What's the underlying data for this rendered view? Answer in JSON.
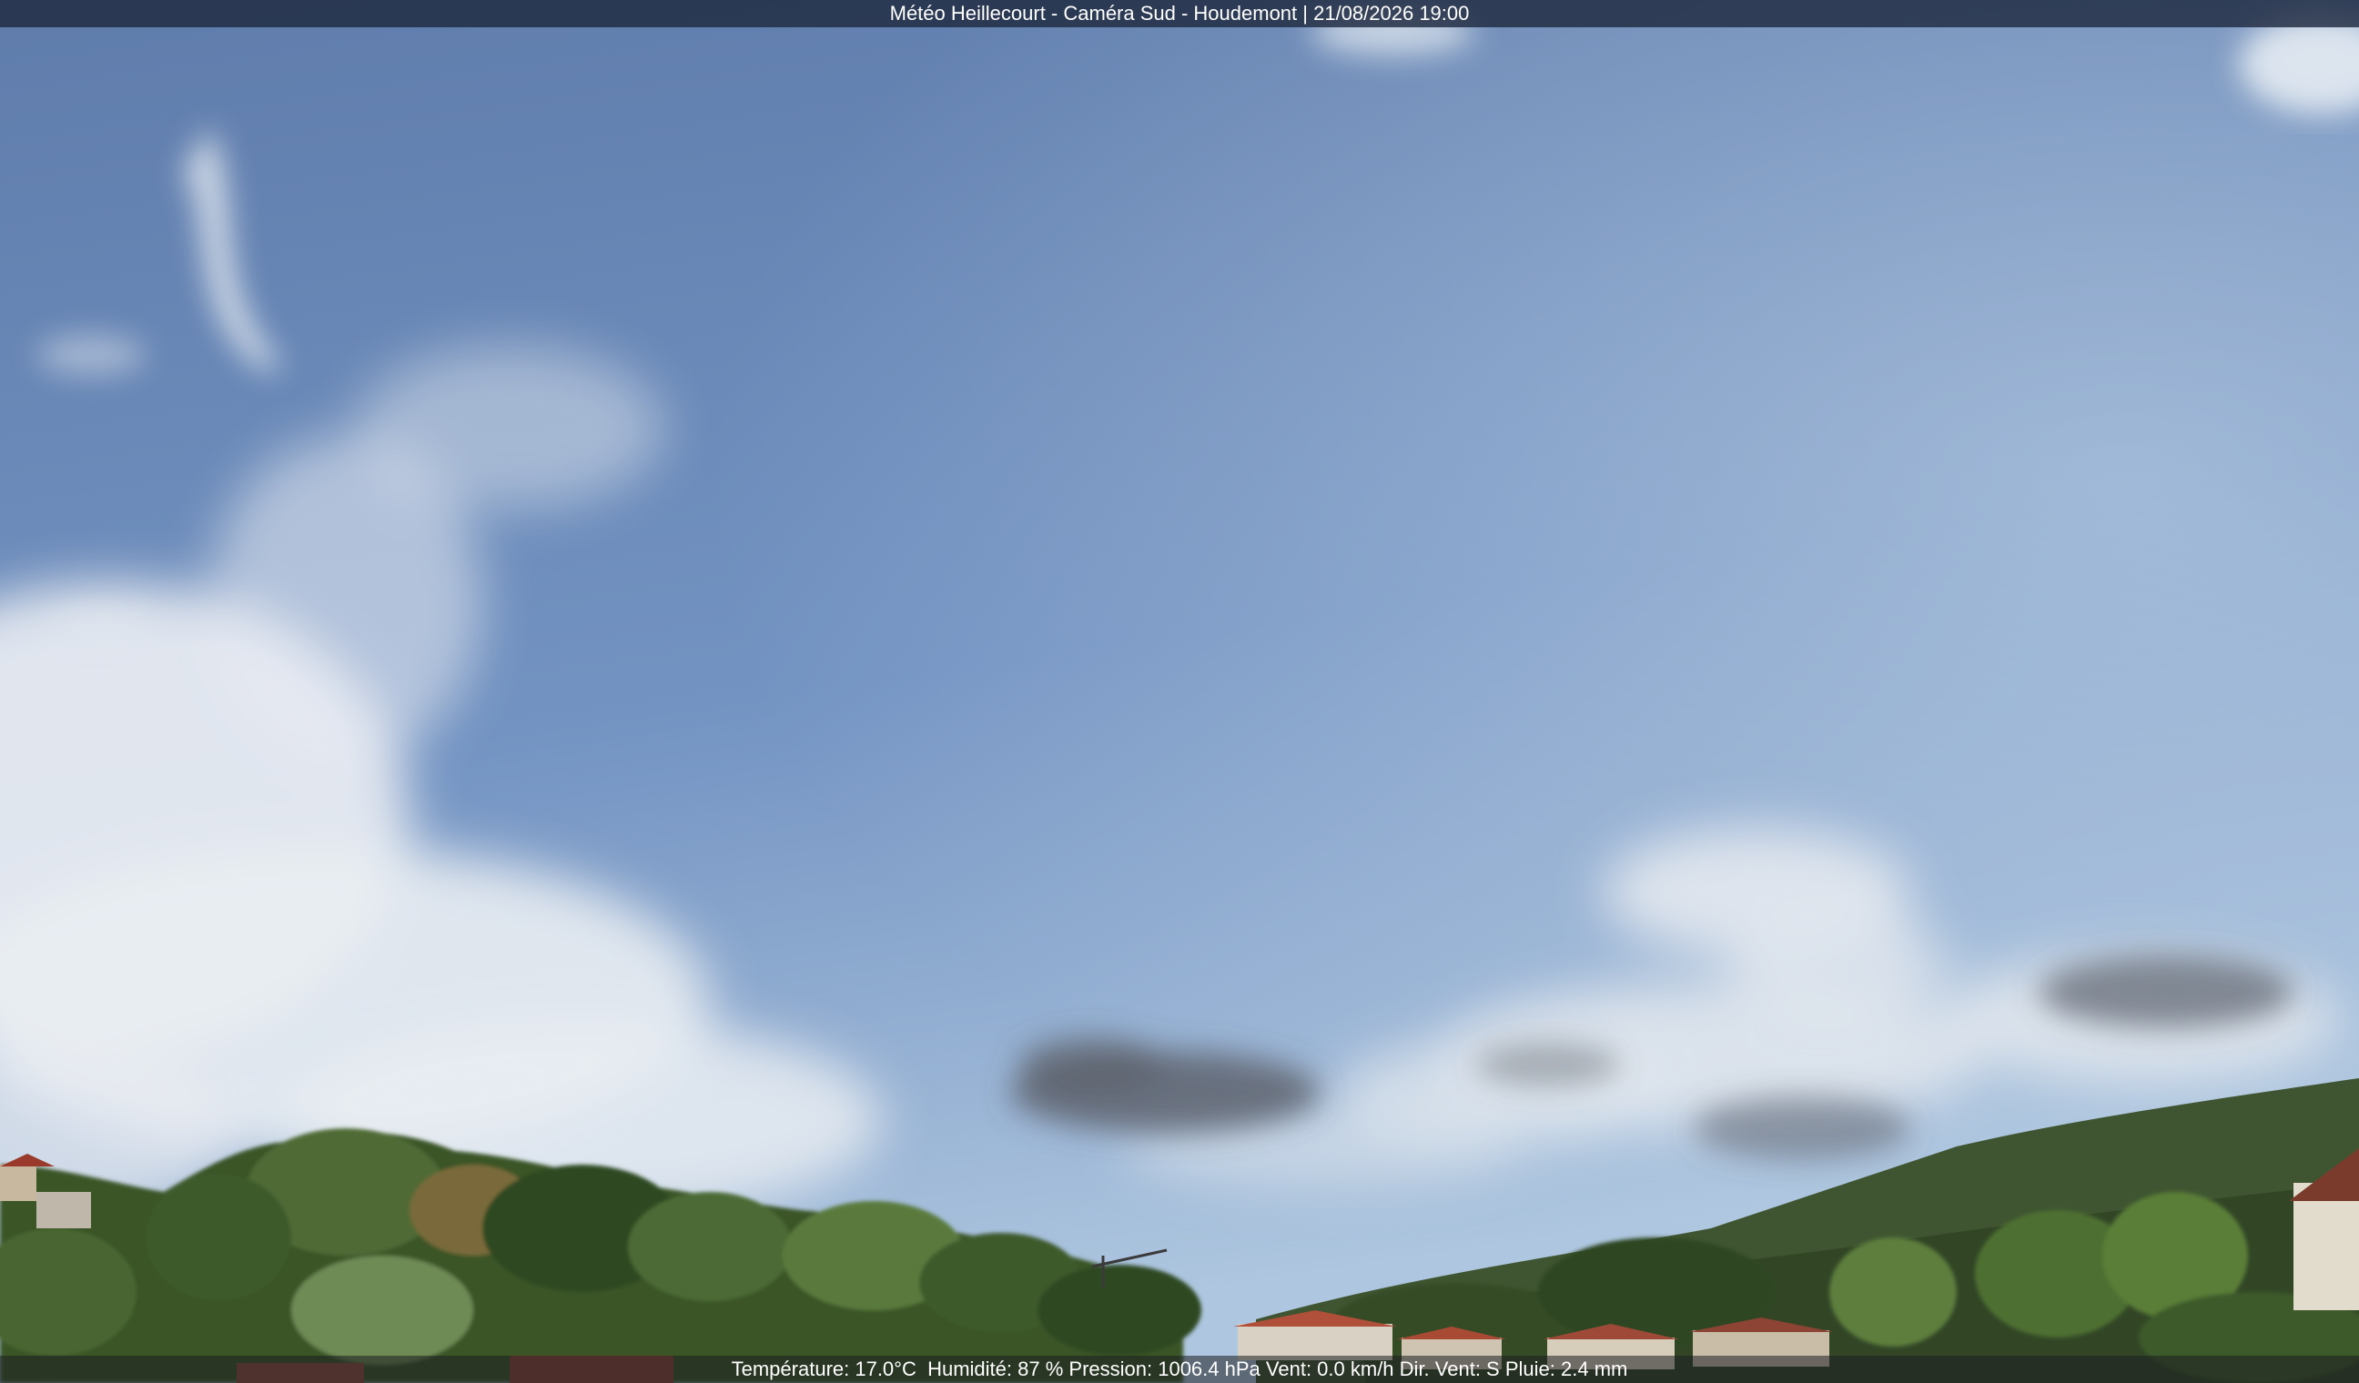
{
  "overlay": {
    "title": "Météo Heillecourt - Caméra Sud - Houdemont | 21/08/2026 19:00",
    "weather": {
      "temperature": "Température: 17.0°C",
      "humidity": "Humidité: 87 %",
      "pressure": "Pression: 1006.4 hPa",
      "wind_speed": "Vent: 0.0 km/h",
      "wind_dir": "Dir. Vent: S",
      "rain": "Pluie: 2.4 mm"
    }
  },
  "colors": {
    "sky_top": "#5f7cab",
    "sky_horizon": "#a9c2dd",
    "cloud": "#e8ecf0",
    "dark_cloud": "#5c626c",
    "foliage": "#2f4a22",
    "roof": "#b0503a"
  }
}
